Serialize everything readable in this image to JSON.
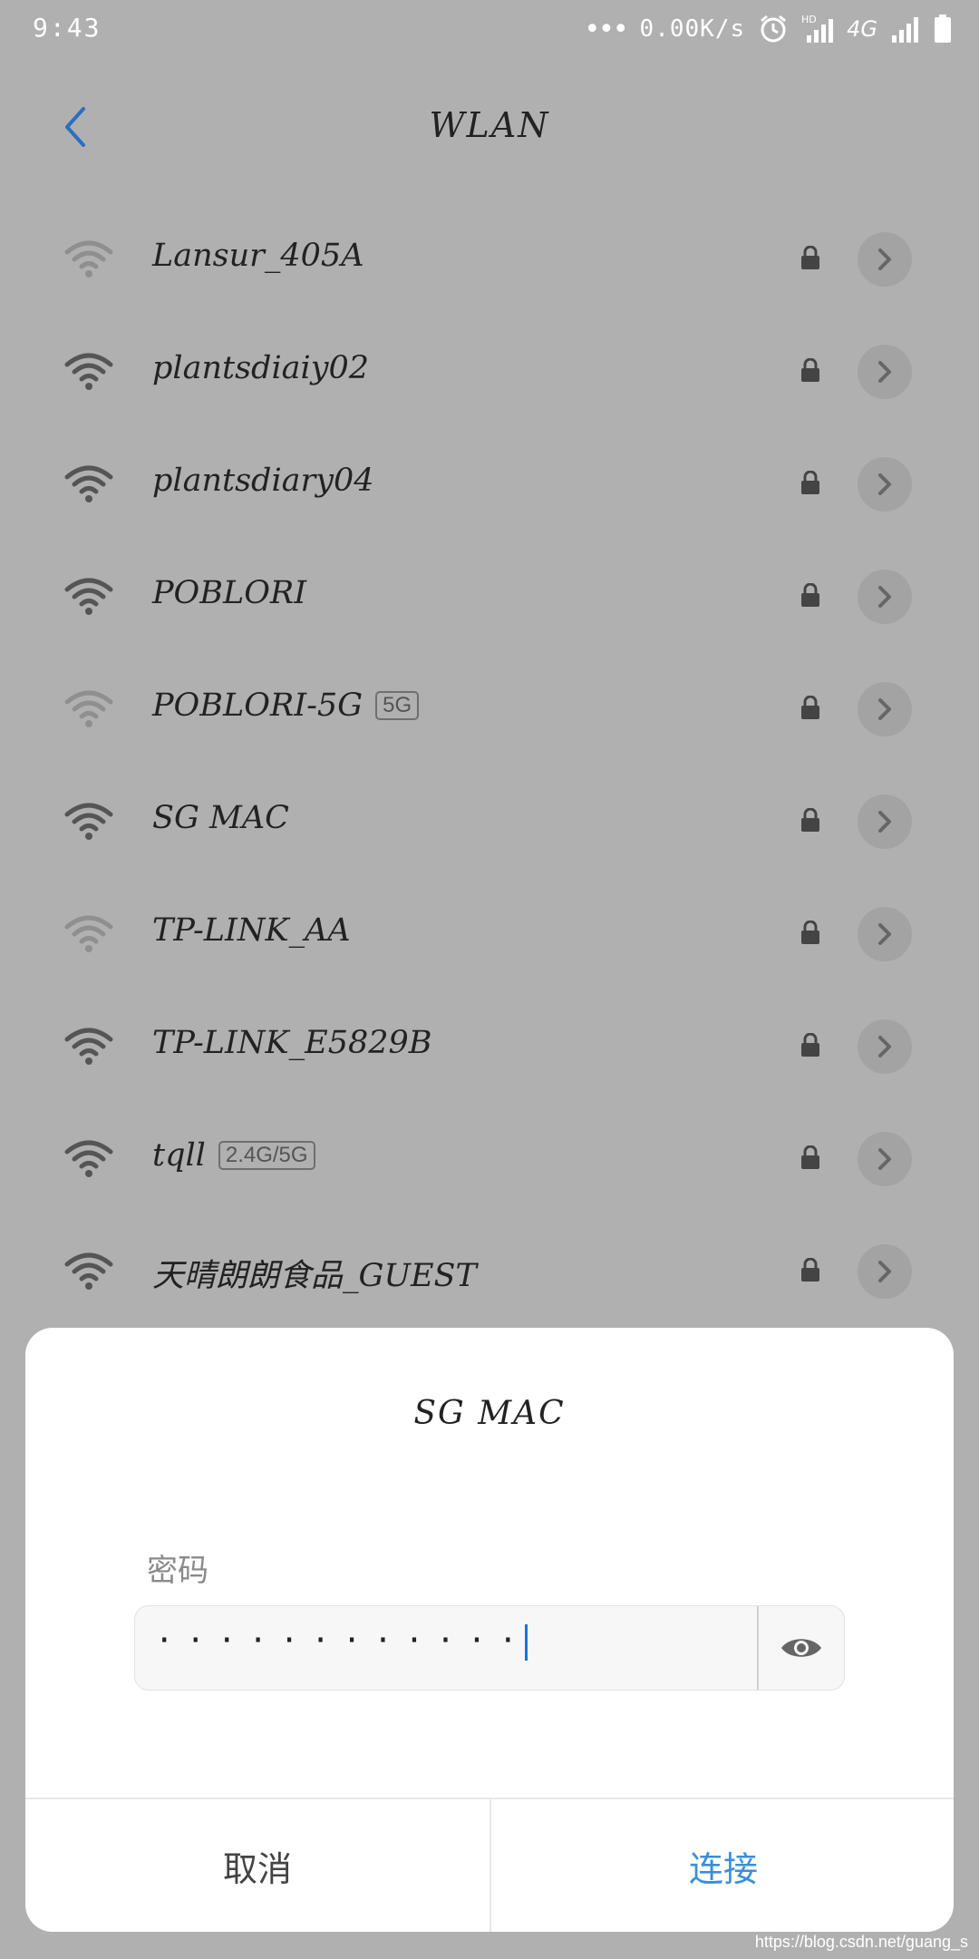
{
  "status_bar": {
    "time": "9:43",
    "dots": "•••",
    "speed": "0.00K/s",
    "network": "4G"
  },
  "header": {
    "title": "WLAN"
  },
  "networks": [
    {
      "ssid": "Lansur_405A",
      "badge": "",
      "signal": "weak"
    },
    {
      "ssid": "plantsdiaiy02",
      "badge": "",
      "signal": "strong"
    },
    {
      "ssid": "plantsdiary04",
      "badge": "",
      "signal": "strong"
    },
    {
      "ssid": "POBLORI",
      "badge": "",
      "signal": "strong"
    },
    {
      "ssid": "POBLORI-5G",
      "badge": "5G",
      "signal": "weak"
    },
    {
      "ssid": "SG  MAC",
      "badge": "",
      "signal": "strong"
    },
    {
      "ssid": "TP-LINK_AA",
      "badge": "",
      "signal": "weak"
    },
    {
      "ssid": "TP-LINK_E5829B",
      "badge": "",
      "signal": "strong"
    },
    {
      "ssid": "tqll",
      "badge": "2.4G/5G",
      "signal": "strong"
    },
    {
      "ssid": "天晴朗朗食品_GUEST",
      "badge": "",
      "signal": "strong"
    }
  ],
  "dialog": {
    "title": "SG  MAC",
    "password_label": "密码",
    "password_value": "············",
    "cancel_label": "取消",
    "connect_label": "连接"
  },
  "colors": {
    "dim_background": "#b0b0b0",
    "accent_blue": "#3a8ed8",
    "back_arrow": "#2a6fc2",
    "icon_strong": "#555555",
    "icon_weak": "#8f8f8f"
  },
  "watermark": "https://blog.csdn.net/guang_s"
}
